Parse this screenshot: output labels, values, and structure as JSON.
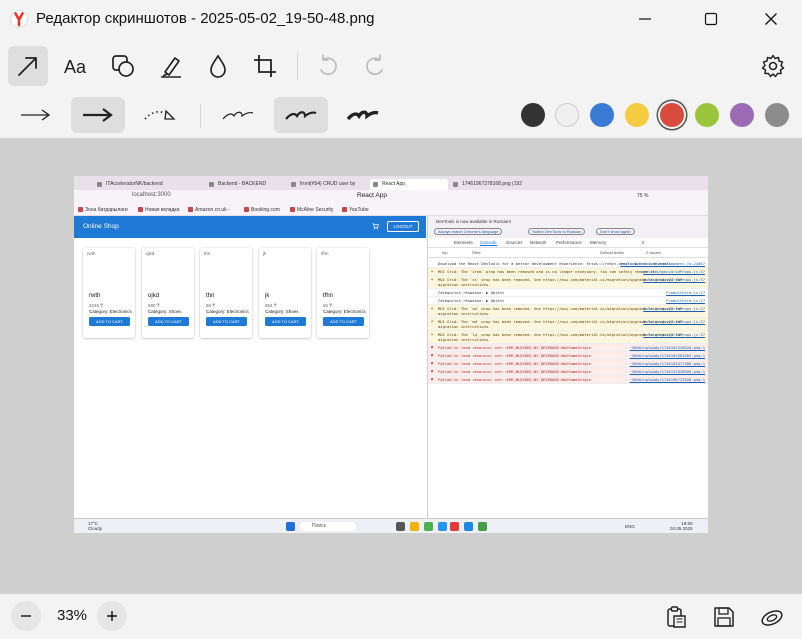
{
  "window": {
    "title": "Редактор скриншотов - 2025-05-02_19-50-48.png"
  },
  "colors": [
    "#333333",
    "#f0f0f0",
    "#3a7bd5",
    "#f5cb42",
    "#d94c3d",
    "#9bc53d",
    "#9b6bb5",
    "#8c8c8c"
  ],
  "selected_color": "#d94c3d",
  "zoom": {
    "value": "33%"
  },
  "screenshot": {
    "tabs": [
      "ITAcceleratorNK/backend",
      "Backend - BACKEND",
      "front(#54) CRUD user by",
      "React App",
      "17461967378168.png (192"
    ],
    "url": "localhost:3000",
    "page_title": "React App",
    "browser_zoom": "75 %",
    "bookmarks": [
      "Зона батдарылаги",
      "Новая вкладка",
      "Amazon.co.uk -",
      "Booking.com",
      "McAfee Security",
      "YouTube"
    ],
    "app": {
      "title": "Online Shop",
      "logout": "LOGOUT",
      "add_to_cart": "ADD TO CART",
      "products": [
        {
          "alt": "rwth",
          "name": "rwth",
          "price": "3245 ₸",
          "category": "Category: Electronics"
        },
        {
          "alt": "ojkd",
          "name": "ojkd",
          "price": "690 ₸",
          "category": "Category: Shoes"
        },
        {
          "alt": "thn",
          "name": "thn",
          "price": "66 ₸",
          "category": "Category: Electronics"
        },
        {
          "alt": "jk",
          "name": "jk",
          "price": "654 ₸",
          "category": "Category: Shoes"
        },
        {
          "alt": "tfhn",
          "name": "tfhn",
          "price": "65 ₸",
          "category": "Category: Electronics"
        }
      ]
    },
    "devtools": {
      "banner": "DevTools is now available in Russian!",
      "banner_buttons": [
        "Always match Chrome's language",
        "Switch DevTools to Russian",
        "Don't show again"
      ],
      "tabs": [
        "Elements",
        "Console",
        "Sources",
        "Network",
        "Performance",
        "Memory"
      ],
      "error_count": "5",
      "filter": {
        "context": "top",
        "placeholder": "Filter",
        "levels": "Default levels",
        "issues": "2 Issues"
      },
      "logs": [
        {
          "level": "info",
          "text": "Download the React DevTools for a better development experience: https://react.dev/link/react-devtools",
          "src": "react-dom-client.development.js:24867"
        },
        {
          "level": "warn",
          "text": "MUI Grid: The `item` prop has been removed and is no longer necessary. You can safely remove it.",
          "src": "deleteLegacyGridProps.js:37"
        },
        {
          "level": "warn",
          "text": "MUI Grid: The `xs` prop has been removed. See https://mui.com/material-ui/migration/upgrade-to-grid-v2/ for migration instructions.",
          "src": "deleteLegacyGridProps.js:37"
        },
        {
          "level": "info",
          "text": "Categories response: ▶ Object",
          "src": "ProductForm.js:17"
        },
        {
          "level": "info",
          "text": "Categories response: ▶ Object",
          "src": "ProductForm.js:17"
        },
        {
          "level": "warn",
          "text": "MUI Grid: The `sm` prop has been removed. See https://mui.com/material-ui/migration/upgrade-to-grid-v2/ for migration instructions.",
          "src": "deleteLegacyGridProps.js:37"
        },
        {
          "level": "warn",
          "text": "MUI Grid: The `md` prop has been removed. See https://mui.com/material-ui/migration/upgrade-to-grid-v2/ for migration instructions.",
          "src": "deleteLegacyGridProps.js:37"
        },
        {
          "level": "warn",
          "text": "MUI Grid: The `lg` prop has been removed. See https://mui.com/material-ui/migration/upgrade-to-grid-v2/ for migration instructions.",
          "src": "deleteLegacyGridProps.js:37"
        },
        {
          "level": "error",
          "text": "Failed to load resource: net::ERR_BLOCKED_BY_RESPONSE.NotSameOrigin",
          "src": ":5000/uploads/1746101516820.png:1"
        },
        {
          "level": "error",
          "text": "Failed to load resource: net::ERR_BLOCKED_BY_RESPONSE.NotSameOrigin",
          "src": ":5000/uploads/1746101981802.png:1"
        },
        {
          "level": "error",
          "text": "Failed to load resource: net::ERR_BLOCKED_BY_RESPONSE.NotSameOrigin",
          "src": ":5000/uploads/1746103477386.png:1"
        },
        {
          "level": "error",
          "text": "Failed to load resource: net::ERR_BLOCKED_BY_RESPONSE.NotSameOrigin",
          "src": ":5000/uploads/1746137028689.png:1"
        },
        {
          "level": "error",
          "text": "Failed to load resource: net::ERR_BLOCKED_BY_RESPONSE.NotSameOrigin",
          "src": ":5000/uploads/1746196737826.png:1"
        }
      ]
    },
    "taskbar": {
      "weather_temp": "17°C",
      "weather_desc": "Cloudy",
      "search": "Поиск",
      "lang": "ENG",
      "time": "19:50",
      "date": "02.05.2025"
    }
  }
}
